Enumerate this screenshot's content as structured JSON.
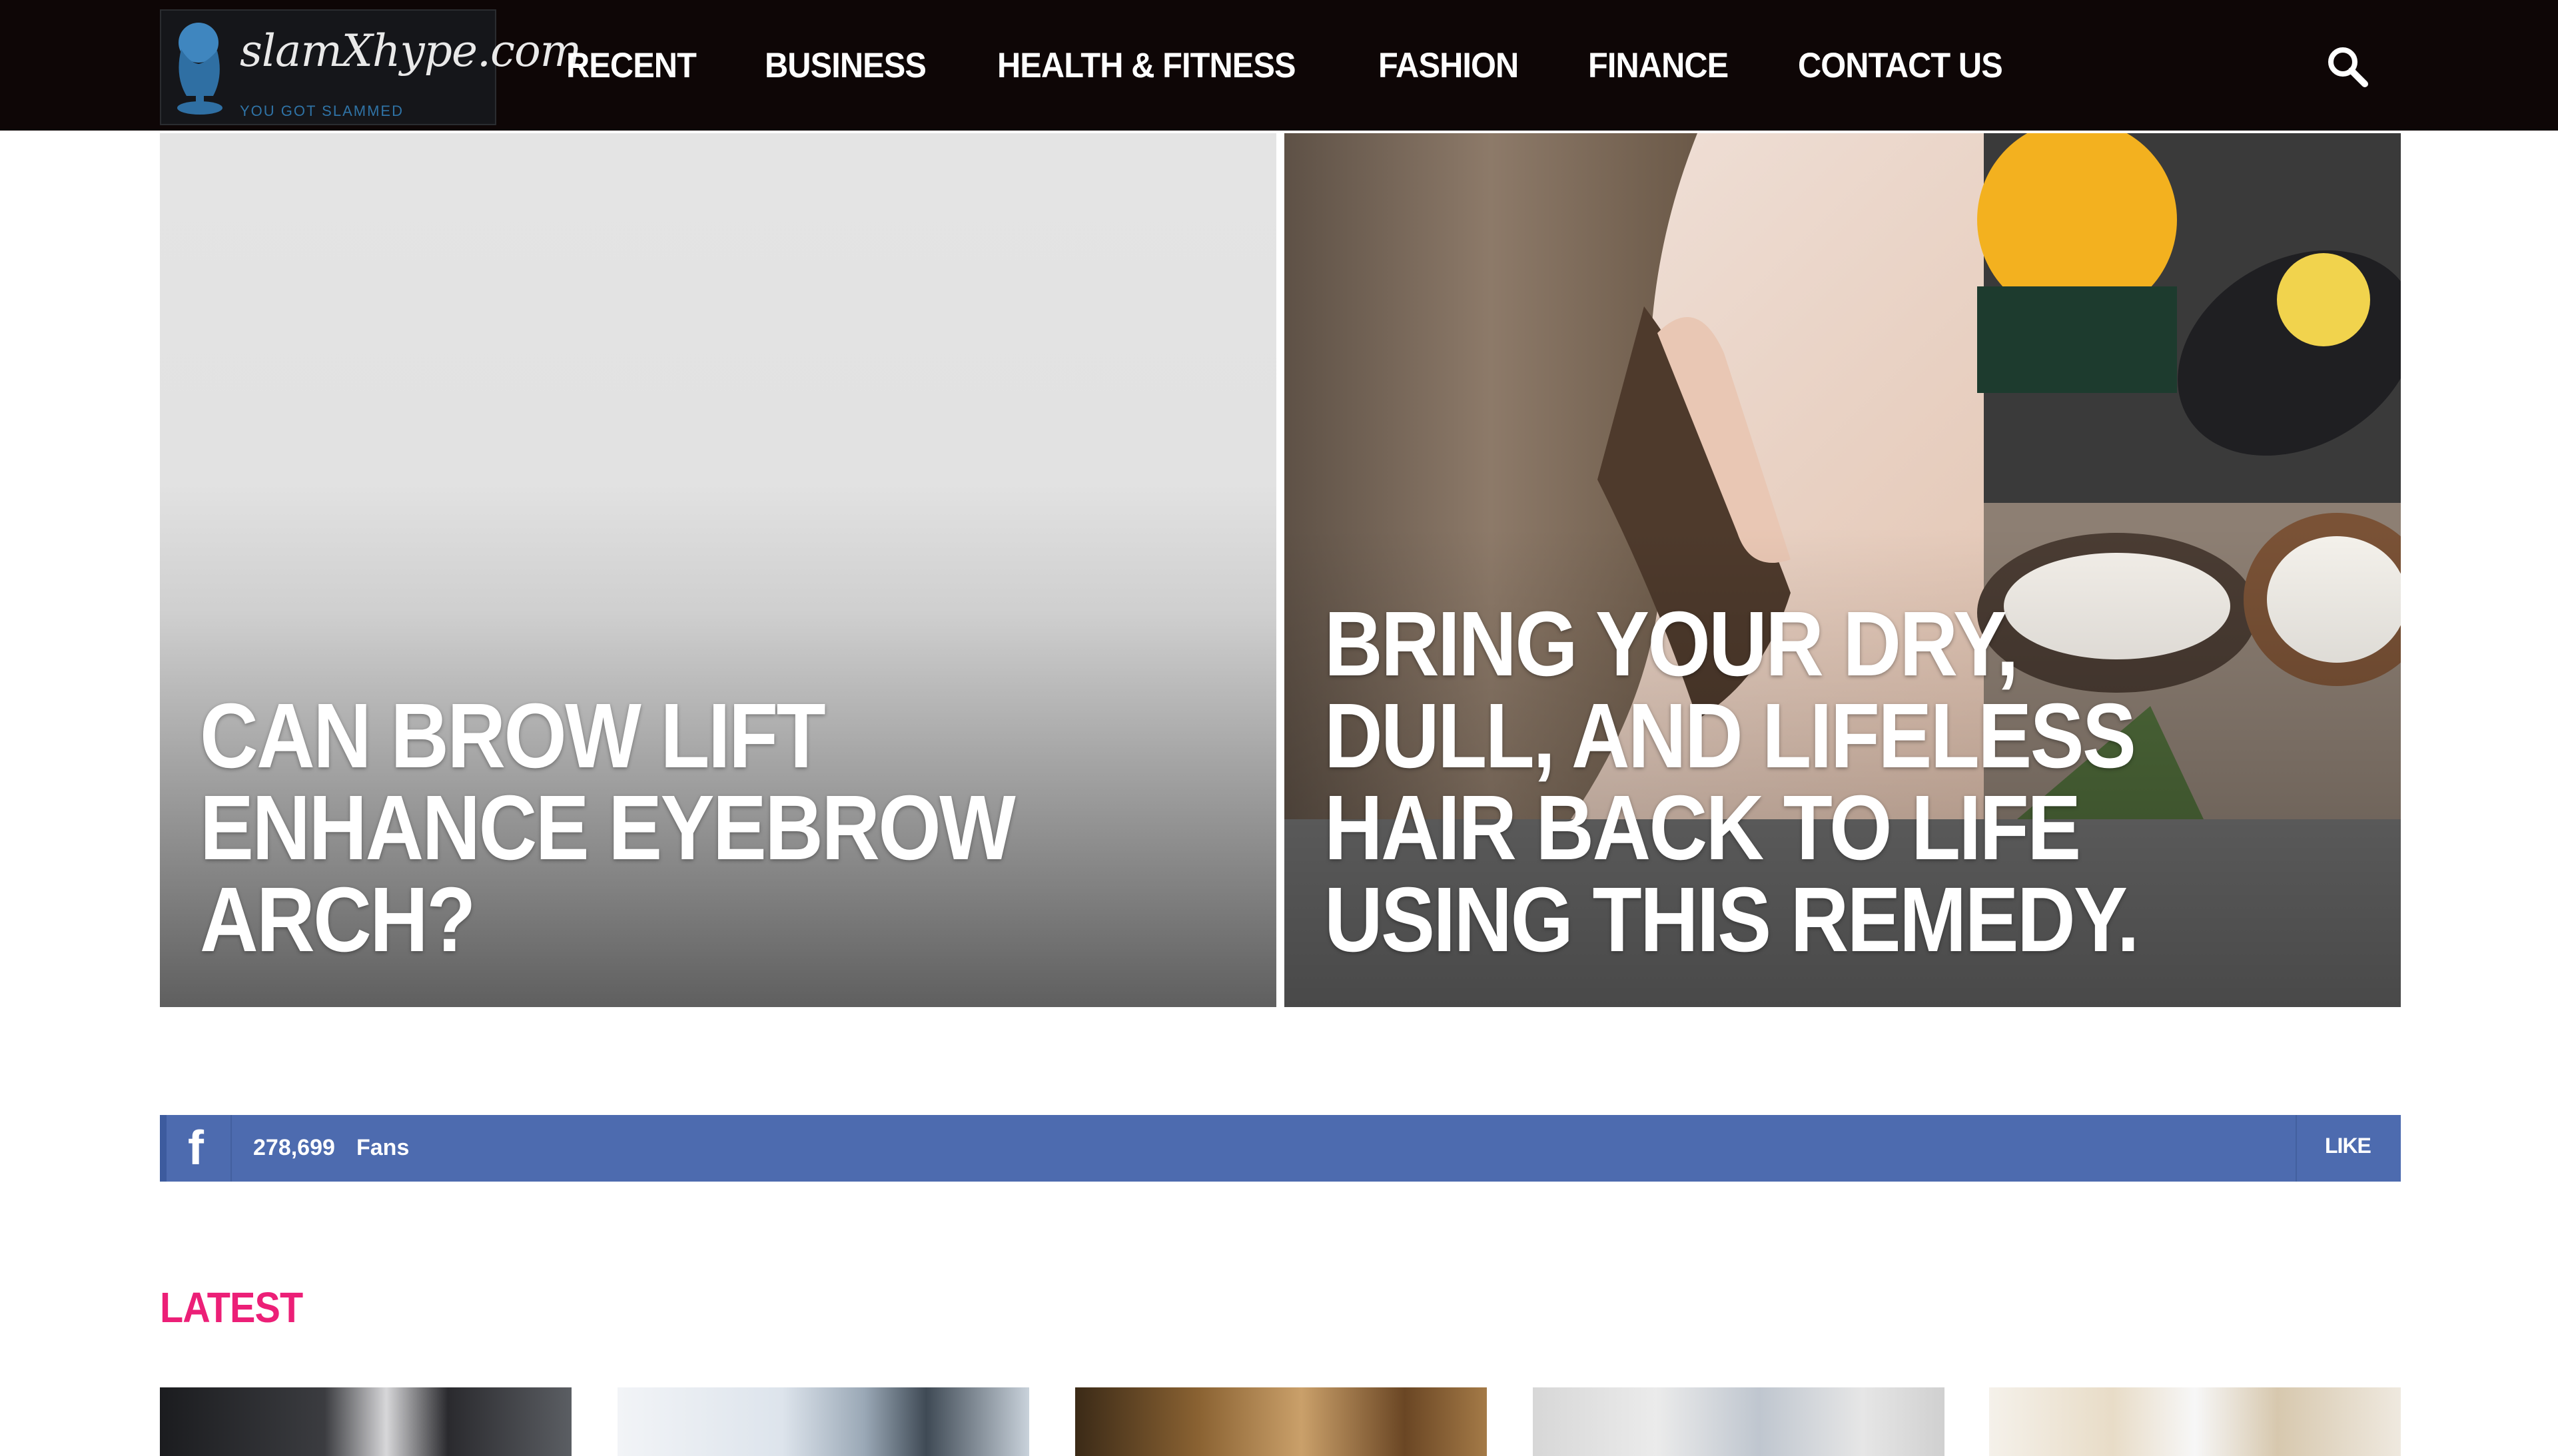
{
  "brand": {
    "logo_text": "slamXhype.com",
    "tagline": "YOU GOT SLAMMED"
  },
  "nav": {
    "items": [
      "RECENT",
      "BUSINESS",
      "HEALTH & FITNESS",
      "FASHION",
      "FINANCE",
      "CONTACT US"
    ],
    "search_icon": "search-icon"
  },
  "featured": [
    {
      "title": "CAN BROW LIFT ENHANCE EYEBROW ARCH?"
    },
    {
      "title": "BRING YOUR DRY, DULL, AND LIFELESS HAIR BACK TO LIFE USING THIS REMEDY."
    }
  ],
  "social": {
    "icon": "facebook-icon",
    "count": "278,699",
    "label": "Fans",
    "action": "LIKE",
    "color": "#4d6baf"
  },
  "latest": {
    "heading": "LATEST",
    "heading_color": "#ec1f77"
  }
}
